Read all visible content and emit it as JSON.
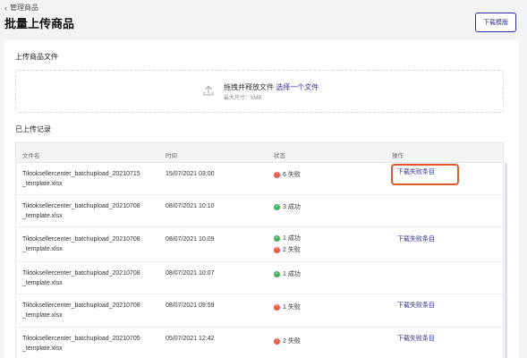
{
  "header": {
    "back_label": "管理商品",
    "title": "批量上传商品",
    "download_template_label": "下载模版"
  },
  "upload": {
    "section_title": "上传商品文件",
    "drop_text": "拖拽并释放文件",
    "select_link": "选择一个文件",
    "max_size_text": "最大尺寸：5MB"
  },
  "records": {
    "section_title": "已上传记录",
    "columns": [
      "文件名",
      "时间",
      "状态",
      "操作"
    ],
    "rows": [
      {
        "file_line1": "Tiktoksellercenter_batchupload_20210715",
        "file_line2": "_template.xlsx",
        "time": "15/07/2021 03:00",
        "status": [
          {
            "type": "fail",
            "text": "6 失败"
          }
        ],
        "action": "下载失败条目"
      },
      {
        "file_line1": "Tiktoksellercenter_batchupload_20210708",
        "file_line2": "_template.xlsx",
        "time": "08/07/2021 10:10",
        "status": [
          {
            "type": "ok",
            "text": "3 成功"
          }
        ],
        "action": ""
      },
      {
        "file_line1": "Tiktoksellercenter_batchupload_20210708",
        "file_line2": "_template.xlsx",
        "time": "08/07/2021 10:09",
        "status": [
          {
            "type": "ok",
            "text": "1 成功"
          },
          {
            "type": "fail",
            "text": "2 失败"
          }
        ],
        "action": "下载失败条目"
      },
      {
        "file_line1": "Tiktoksellercenter_batchupload_20210708",
        "file_line2": "_template.xlsx",
        "time": "08/07/2021 10:07",
        "status": [
          {
            "type": "ok",
            "text": "1 成功"
          }
        ],
        "action": ""
      },
      {
        "file_line1": "Tiktoksellercenter_batchupload_20210708",
        "file_line2": "_template.xlsx",
        "time": "08/07/2021 09:59",
        "status": [
          {
            "type": "fail",
            "text": "1 失败"
          }
        ],
        "action": "下载失败条目"
      },
      {
        "file_line1": "Tiktoksellercenter_batchupload_20210705",
        "file_line2": "_template.xlsx",
        "time": "05/07/2021 12:42",
        "status": [
          {
            "type": "fail",
            "text": "2 失败"
          }
        ],
        "action": "下载失败条目"
      }
    ]
  },
  "colors": {
    "accent": "#2c2f9e",
    "fail": "#e8594a",
    "success": "#3fb55b",
    "highlight": "#e05a2b"
  }
}
